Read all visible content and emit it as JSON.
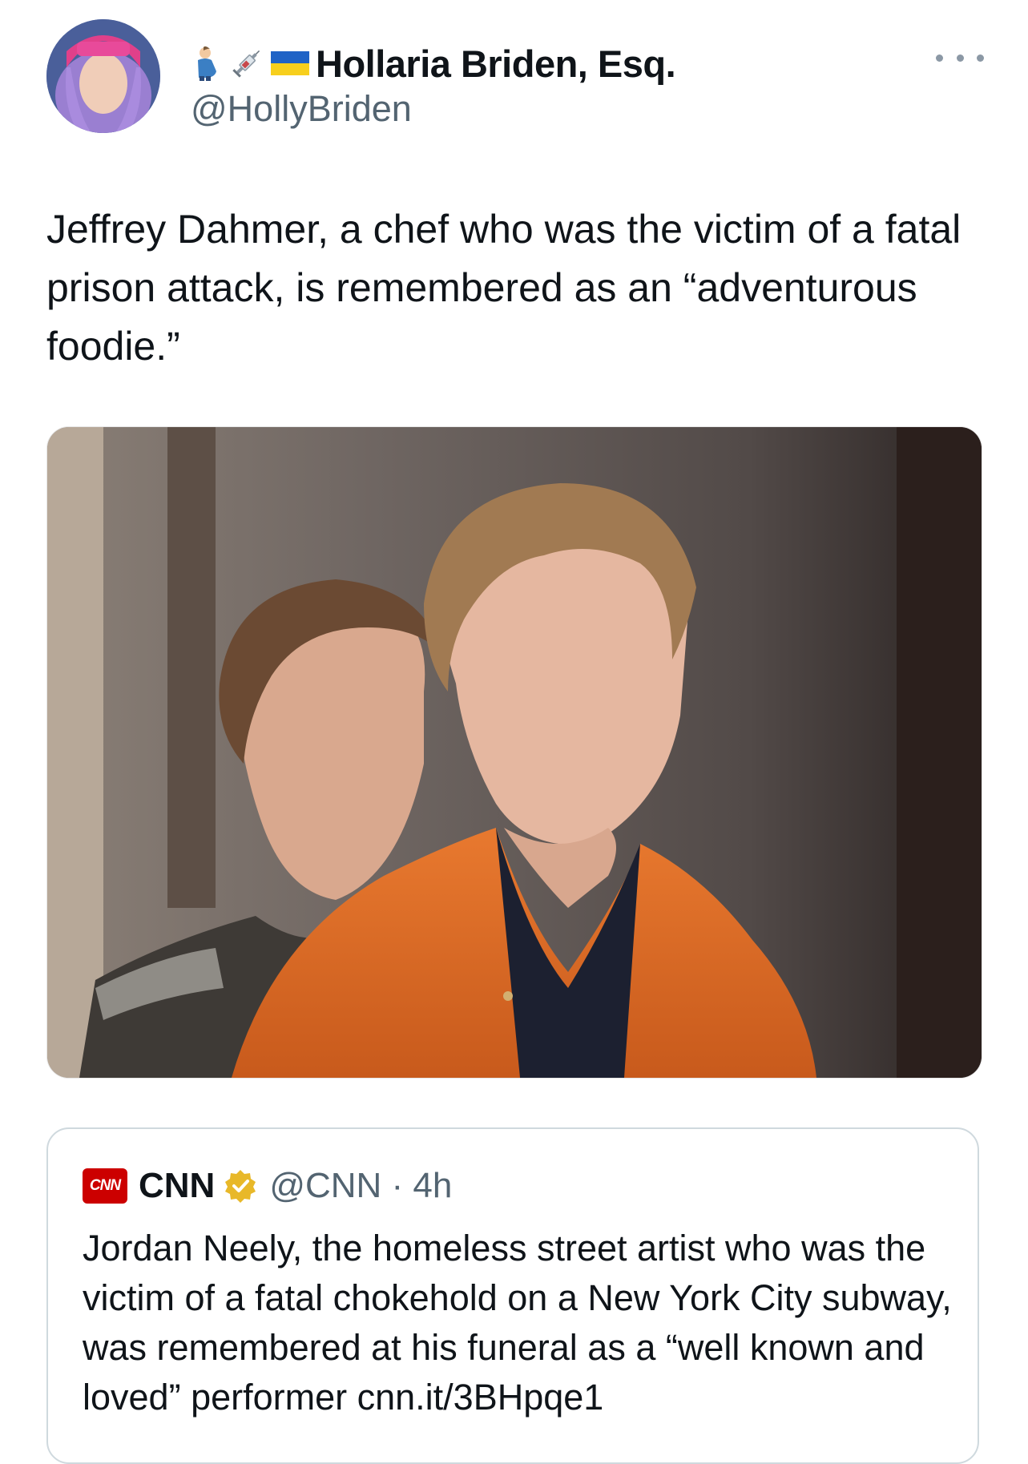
{
  "tweet": {
    "display_name": "Hollaria Briden, Esq.",
    "handle": "@HollyBriden",
    "name_emojis": [
      "pregnant-man-emoji",
      "syringe-emoji",
      "ukraine-flag-emoji"
    ],
    "text": "Jeffrey Dahmer, a chef who was the victim of a fatal prison attack, is remembered as an “adventurous foodie.”",
    "media": "photo-two-men-orange-jumpsuit"
  },
  "quoted_tweet": {
    "logo_text": "CNN",
    "name": "CNN",
    "handle_time": "@CNN · 4h",
    "text": "Jordan Neely, the homeless street artist who was the victim of a fatal chokehold on a New York City subway, was remembered at his funeral as a “well known and loved” performer cnn.it/3BHpqe1"
  },
  "colors": {
    "text": "#0f1419",
    "secondary": "#536471",
    "border": "#cfd9de",
    "cnn_red": "#cc0000",
    "verified_gold": "#e8b829"
  }
}
